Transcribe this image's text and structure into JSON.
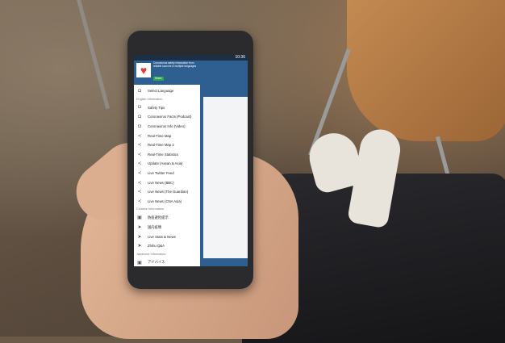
{
  "status_bar": {
    "time": "10:36"
  },
  "drawer": {
    "header": {
      "description": "Coronavirus safety information from reliable sources in multiple languages",
      "share_label": "Share"
    },
    "select_language": "Select Language",
    "sections": [
      {
        "title": "English Information",
        "items": [
          {
            "label": "Safety Tips",
            "icon": "camera-icon"
          },
          {
            "label": "Coronavirus Facts (Podcast)",
            "icon": "camera-icon"
          },
          {
            "label": "Coronavirus Info (Video)",
            "icon": "camera-icon"
          },
          {
            "label": "Real-Time Map",
            "icon": "share-icon"
          },
          {
            "label": "Real-Time Map 2",
            "icon": "share-icon"
          },
          {
            "label": "Real-Time Statistics",
            "icon": "share-icon"
          },
          {
            "label": "Update (Asean & Asia)",
            "icon": "share-icon"
          },
          {
            "label": "Live Twitter Feed",
            "icon": "share-icon"
          },
          {
            "label": "Live News (BBC)",
            "icon": "share-icon"
          },
          {
            "label": "Live News (The Guardian)",
            "icon": "share-icon"
          },
          {
            "label": "Live News (CNA Asia)",
            "icon": "share-icon"
          }
        ]
      },
      {
        "title": "Chinese Information",
        "items": [
          {
            "label": "防疫避险提示",
            "icon": "gallery-icon"
          },
          {
            "label": "国内疫情",
            "icon": "send-icon"
          },
          {
            "label": "Live Stats & News",
            "icon": "send-icon"
          },
          {
            "label": "Zhihu Q&A",
            "icon": "send-icon"
          }
        ]
      },
      {
        "title": "Japanese Information",
        "items": [
          {
            "label": "アドバイス",
            "icon": "gallery-icon"
          }
        ]
      }
    ]
  },
  "colors": {
    "header_blue": "#2f5f91",
    "share_green": "#2ea84e",
    "heart_red": "#e23b3b"
  }
}
